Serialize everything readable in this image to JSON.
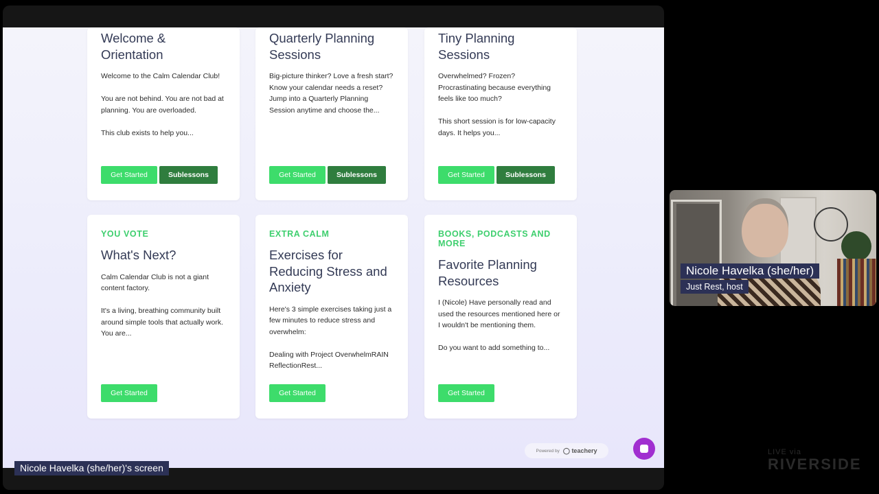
{
  "cards": [
    {
      "category": "",
      "title": "Welcome & Orientation",
      "description": "Welcome to the Calm Calendar Club!\n\nYou are not behind. You are not bad at planning. You are overloaded.\n\nThis club exists to help you...",
      "start_label": "Get Started",
      "sub_label": "Sublessons"
    },
    {
      "category": "",
      "title": "Quarterly Planning Sessions",
      "description": "Big-picture thinker? Love a fresh start? Know your calendar needs a reset?\nJump into a Quarterly Planning Session anytime and choose the...",
      "start_label": "Get Started",
      "sub_label": "Sublessons"
    },
    {
      "category": "",
      "title": "Tiny Planning Sessions",
      "description": "Overwhelmed? Frozen? Procrastinating because everything feels like too much?\n\nThis short session is for low-capacity days. It helps you...",
      "start_label": "Get Started",
      "sub_label": "Sublessons"
    },
    {
      "category": "YOU VOTE",
      "title": "What's Next?",
      "description": "Calm Calendar Club is not a giant content factory.\n\nIt's a living, breathing community built around simple tools that actually work.\nYou are...",
      "start_label": "Get Started"
    },
    {
      "category": "EXTRA CALM",
      "title": "Exercises for Reducing Stress and Anxiety",
      "description": "Here's 3 simple exercises taking just a few minutes to reduce stress and overwhelm:\n\nDealing with Project OverwhelmRAIN ReflectionRest...",
      "start_label": "Get Started"
    },
    {
      "category": "BOOKS, PODCASTS AND MORE",
      "title": "Favorite Planning Resources",
      "description": "I (Nicole) Have personally read and used the resources mentioned here or I wouldn't be mentioning them.\n\nDo you want to add something to...",
      "start_label": "Get Started"
    }
  ],
  "footer": {
    "powered_by": "Powered by",
    "brand": "teachery"
  },
  "screen_label": "Nicole Havelka (she/her)'s screen",
  "participant": {
    "name": "Nicole Havelka (she/her)",
    "role": "Just Rest, host"
  },
  "watermark": {
    "line1": "LIVE via",
    "line2": "RIVERSIDE"
  },
  "colors": {
    "accent": "#3ddc6b",
    "accent_dark": "#2f7d3e",
    "title": "#333a55",
    "name_tag": "#2c3156",
    "chat": "#a12fd0"
  }
}
